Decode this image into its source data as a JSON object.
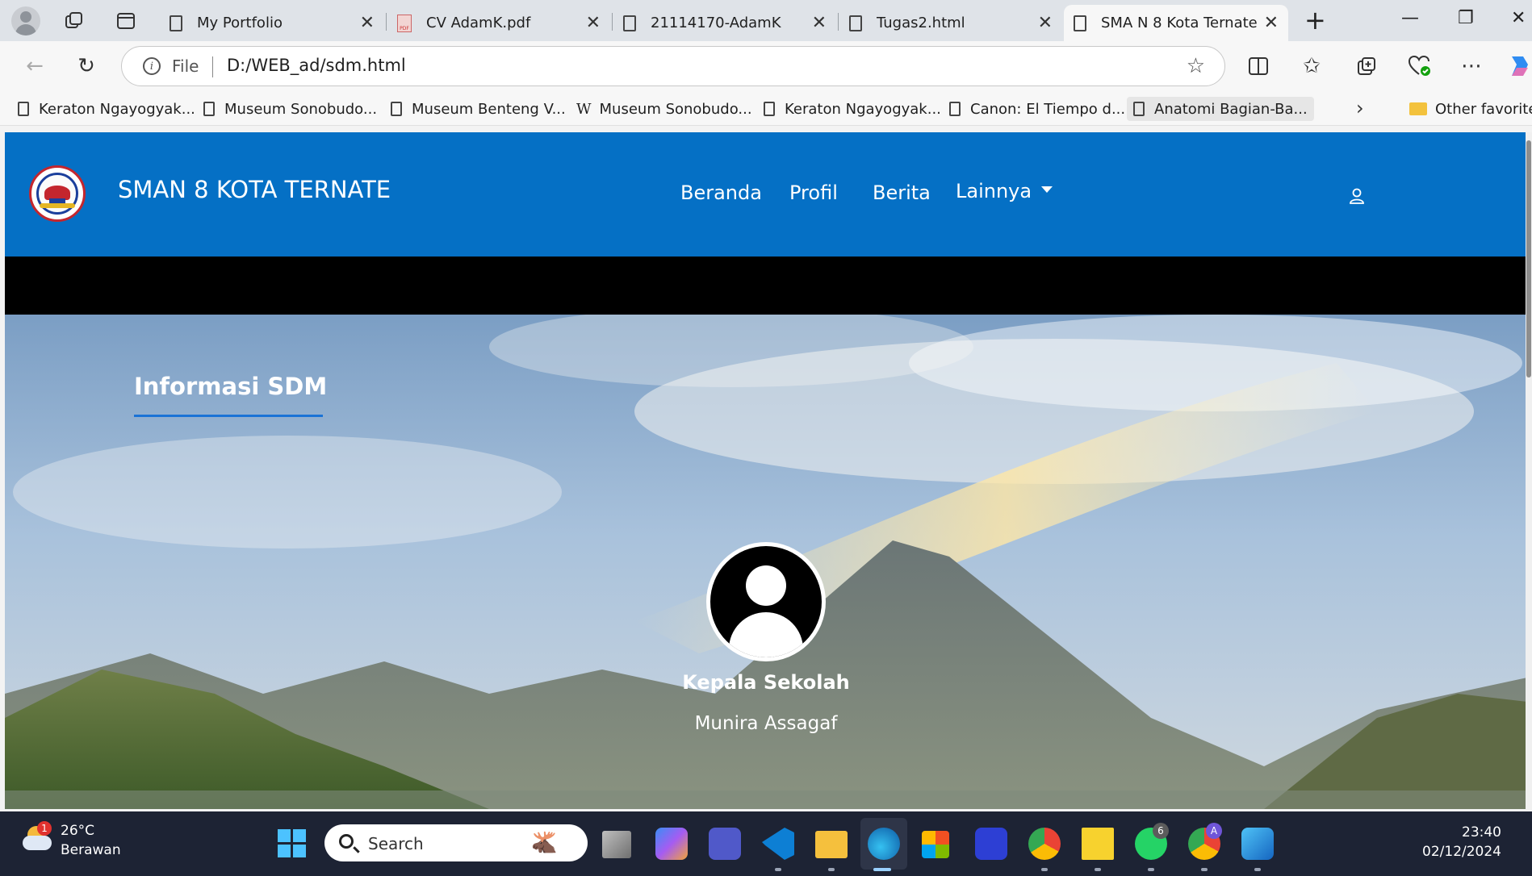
{
  "browser": {
    "tabs": [
      {
        "label": "My Portfolio",
        "icon": "page-icon"
      },
      {
        "label": "CV AdamK.pdf",
        "icon": "pdf-icon"
      },
      {
        "label": "21114170-AdamK",
        "icon": "page-icon"
      },
      {
        "label": "Tugas2.html",
        "icon": "page-icon"
      },
      {
        "label": "SMA N 8 Kota Ternate",
        "icon": "page-icon",
        "active": true
      }
    ],
    "address": {
      "scheme_label": "File",
      "url": "D:/WEB_ad/sdm.html"
    },
    "favorites": [
      {
        "label": "Keraton Ngayogyak...",
        "icon": "page-icon"
      },
      {
        "label": "Museum Sonobudo...",
        "icon": "page-icon"
      },
      {
        "label": "Museum Benteng V...",
        "icon": "page-icon"
      },
      {
        "label": "Museum Sonobudo...",
        "icon": "wikipedia-icon"
      },
      {
        "label": "Keraton Ngayogyak...",
        "icon": "page-icon"
      },
      {
        "label": "Canon: El Tiempo d...",
        "icon": "page-icon"
      },
      {
        "label": "Anatomi Bagian-Ba...",
        "icon": "page-icon",
        "active": true
      }
    ],
    "other_favorites": "Other favorites"
  },
  "site": {
    "brand": "SMAN 8 KOTA TERNATE",
    "nav": [
      "Beranda",
      "Profil",
      "Berita",
      "Lainnya"
    ],
    "colors": {
      "navbar": "#0570c5",
      "accent": "#1a73d6"
    },
    "section_title": "Informasi SDM",
    "staff": {
      "role": "Kepala Sekolah",
      "name": "Munira Assagaf"
    }
  },
  "taskbar": {
    "weather": {
      "temp": "26°C",
      "condition": "Berawan",
      "badge": "1"
    },
    "search_placeholder": "Search",
    "whatsapp_badge": "6",
    "chrome_profile_badge": "A",
    "time": "23:40",
    "date": "02/12/2024"
  }
}
